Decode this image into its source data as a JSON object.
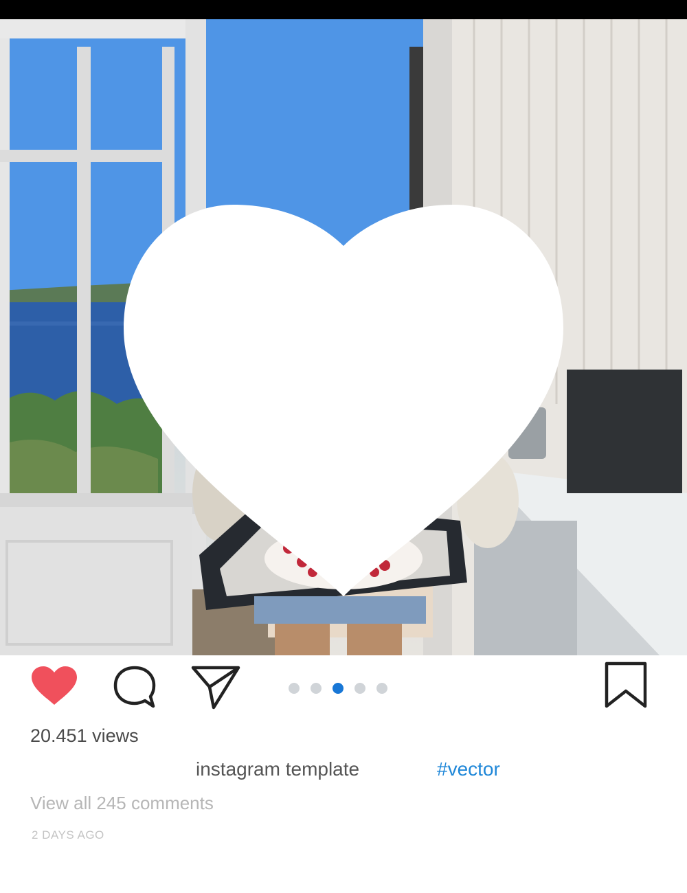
{
  "post": {
    "views": "20.451 views",
    "caption": "instagram template",
    "hashtag": "#vector",
    "comments_link": "View all 245 comments",
    "time_ago": "2 DAYS AGO"
  },
  "actions": {
    "like_icon": "heart-icon",
    "comment_icon": "comment-icon",
    "share_icon": "send-icon",
    "save_icon": "bookmark-icon",
    "like_active": true,
    "like_color": "#f0505c"
  },
  "carousel": {
    "total": 5,
    "active_index": 2,
    "active_color": "#1877d6"
  },
  "photo": {
    "overlay_icon": "heart-icon"
  }
}
